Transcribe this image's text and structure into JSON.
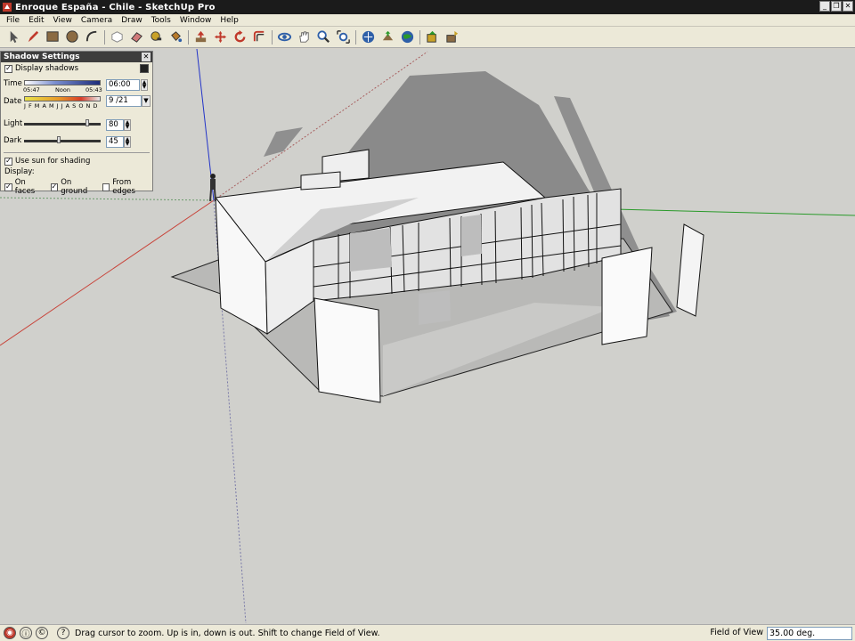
{
  "window": {
    "title": "Enroque España - Chile - SketchUp Pro"
  },
  "menu": [
    "File",
    "Edit",
    "View",
    "Camera",
    "Draw",
    "Tools",
    "Window",
    "Help"
  ],
  "toolbar": [
    {
      "name": "select-tool-icon",
      "color": "#555555"
    },
    {
      "name": "pencil-tool-icon",
      "color": "#c0392b"
    },
    {
      "name": "rectangle-tool-icon",
      "color": "#8b6b43"
    },
    {
      "name": "circle-tool-icon",
      "color": "#8b6b43"
    },
    {
      "name": "arc-tool-icon",
      "color": "#333333"
    },
    {
      "sep": true
    },
    {
      "name": "make-component-icon",
      "color": "#888888"
    },
    {
      "name": "eraser-tool-icon",
      "color": "#d07a7a"
    },
    {
      "name": "tape-measure-icon",
      "color": "#c9a227"
    },
    {
      "name": "paint-bucket-icon",
      "color": "#b87a2a"
    },
    {
      "sep": true
    },
    {
      "name": "push-pull-icon",
      "color": "#c0392b"
    },
    {
      "name": "move-tool-icon",
      "color": "#c0392b"
    },
    {
      "name": "rotate-tool-icon",
      "color": "#c0392b"
    },
    {
      "name": "offset-tool-icon",
      "color": "#c0392b"
    },
    {
      "sep": true
    },
    {
      "name": "orbit-tool-icon",
      "color": "#2e5fa8"
    },
    {
      "name": "pan-tool-icon",
      "color": "#666666"
    },
    {
      "name": "zoom-tool-icon",
      "color": "#2e5fa8"
    },
    {
      "name": "zoom-extents-icon",
      "color": "#2e5fa8"
    },
    {
      "sep": true
    },
    {
      "name": "get-models-icon",
      "color": "#2e5fa8"
    },
    {
      "name": "share-model-icon",
      "color": "#8b6b43"
    },
    {
      "name": "google-earth-icon",
      "color": "#2e5fa8"
    },
    {
      "sep": true
    },
    {
      "name": "get-components-icon",
      "color": "#c9a227"
    },
    {
      "name": "share-component-icon",
      "color": "#8b6b43"
    }
  ],
  "shadow_settings": {
    "title": "Shadow Settings",
    "display_shadows_label": "Display shadows",
    "display_shadows_checked": true,
    "time_label": "Time",
    "time_start": "05:47",
    "time_noon": "Noon",
    "time_end": "05:43",
    "time_value": "06:00",
    "date_label": "Date",
    "months": "J F M A M J J A S O N D",
    "date_value": "9 /21",
    "light_label": "Light",
    "light_value": "80",
    "dark_label": "Dark",
    "dark_value": "45",
    "use_sun_label": "Use sun for shading",
    "use_sun_checked": true,
    "display_label": "Display:",
    "on_faces_label": "On faces",
    "on_faces_checked": true,
    "on_ground_label": "On ground",
    "on_ground_checked": true,
    "from_edges_label": "From edges",
    "from_edges_checked": false
  },
  "status": {
    "message": "Drag cursor to zoom.  Up is in, down is out.  Shift to change Field of View.",
    "vcb_label": "Field of View",
    "vcb_value": "35.00 deg."
  },
  "colors": {
    "axis_red": "#c8443a",
    "axis_green": "#2a9a2a",
    "axis_blue": "#2233c8",
    "shadow": "#8a8a8a",
    "background": "#d0d0cc"
  }
}
